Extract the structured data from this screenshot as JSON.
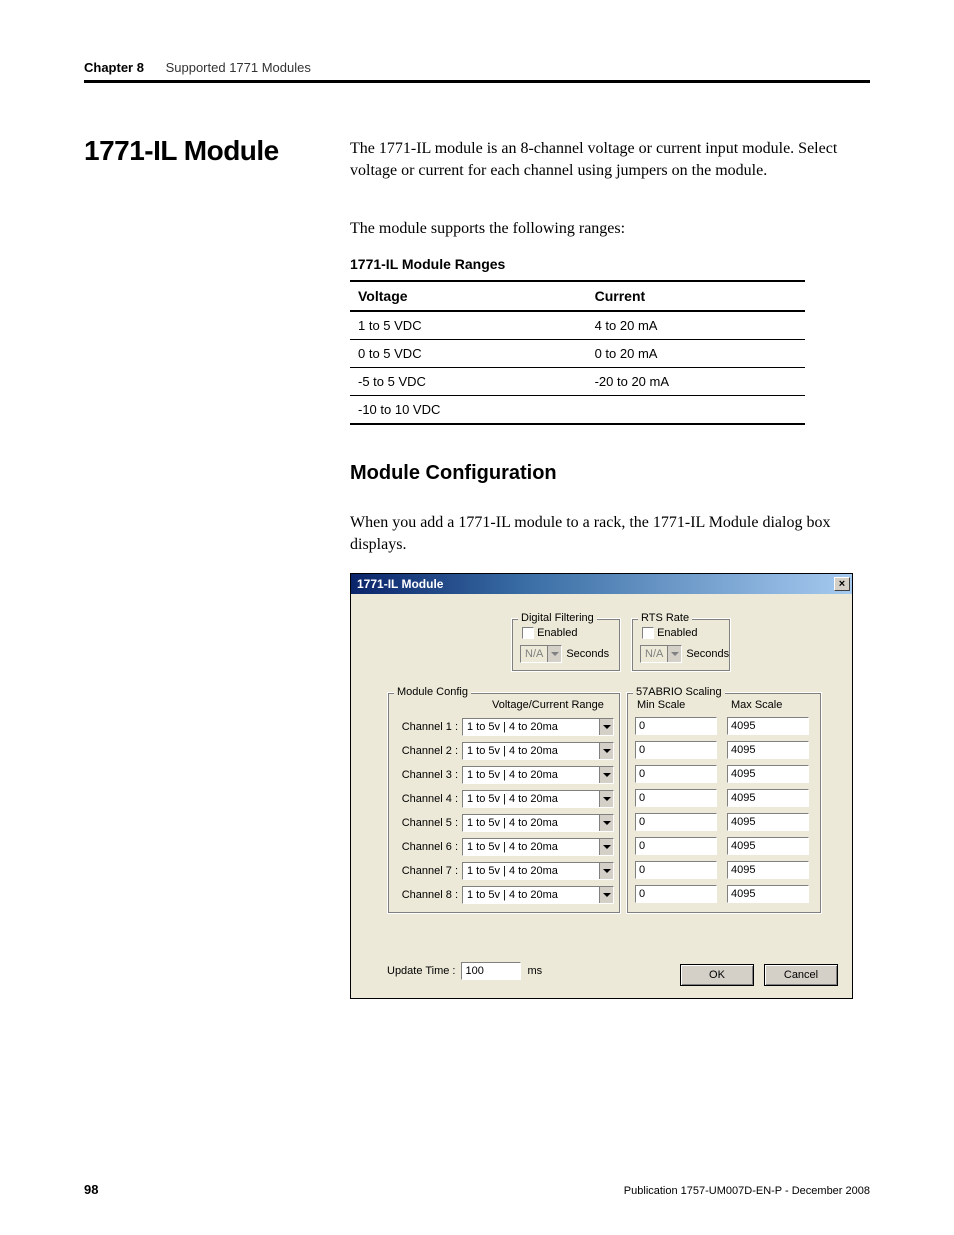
{
  "header": {
    "chapter_label": "Chapter 8",
    "chapter_title": "Supported 1771 Modules"
  },
  "section_heading": "1771-IL Module",
  "paragraph_1": "The 1771-IL module is an 8-channel voltage or current input module. Select voltage or current for each channel using jumpers on the module.",
  "paragraph_2": "The module supports the following ranges:",
  "ranges_table": {
    "caption": "1771-IL Module Ranges",
    "headers": {
      "voltage": "Voltage",
      "current": "Current"
    },
    "rows": [
      {
        "voltage": "1 to 5 VDC",
        "current": "4 to 20 mA"
      },
      {
        "voltage": "0 to 5 VDC",
        "current": "0 to 20 mA"
      },
      {
        "voltage": "-5 to 5 VDC",
        "current": "-20 to 20 mA"
      },
      {
        "voltage": "-10 to 10 VDC",
        "current": ""
      }
    ]
  },
  "sub_heading": "Module Configuration",
  "paragraph_3": "When you add a 1771-IL module to a rack, the 1771-IL Module dialog box displays.",
  "dialog": {
    "title": "1771-IL Module",
    "digital_filtering": {
      "legend": "Digital Filtering",
      "enabled_label": "Enabled",
      "combo_value": "N/A",
      "unit": "Seconds"
    },
    "rts_rate": {
      "legend": "RTS Rate",
      "enabled_label": "Enabled",
      "combo_value": "N/A",
      "unit": "Seconds"
    },
    "module_config": {
      "legend": "Module Config",
      "column_header": "Voltage/Current Range",
      "channels": [
        {
          "label": "Channel 1 :",
          "value": "1 to 5v | 4 to 20ma"
        },
        {
          "label": "Channel 2 :",
          "value": "1 to 5v | 4 to 20ma"
        },
        {
          "label": "Channel 3 :",
          "value": "1 to 5v | 4 to 20ma"
        },
        {
          "label": "Channel 4 :",
          "value": "1 to 5v | 4 to 20ma"
        },
        {
          "label": "Channel 5 :",
          "value": "1 to 5v | 4 to 20ma"
        },
        {
          "label": "Channel 6 :",
          "value": "1 to 5v | 4 to 20ma"
        },
        {
          "label": "Channel 7 :",
          "value": "1 to 5v | 4 to 20ma"
        },
        {
          "label": "Channel 8 :",
          "value": "1 to 5v | 4 to 20ma"
        }
      ]
    },
    "scaling": {
      "legend": "57ABRIO Scaling",
      "min_header": "Min Scale",
      "max_header": "Max Scale",
      "rows": [
        {
          "min": "0",
          "max": "4095"
        },
        {
          "min": "0",
          "max": "4095"
        },
        {
          "min": "0",
          "max": "4095"
        },
        {
          "min": "0",
          "max": "4095"
        },
        {
          "min": "0",
          "max": "4095"
        },
        {
          "min": "0",
          "max": "4095"
        },
        {
          "min": "0",
          "max": "4095"
        },
        {
          "min": "0",
          "max": "4095"
        }
      ]
    },
    "update_time": {
      "label": "Update Time :",
      "value": "100",
      "unit": "ms"
    },
    "buttons": {
      "ok": "OK",
      "cancel": "Cancel"
    }
  },
  "footer": {
    "page_number": "98",
    "publication": "Publication 1757-UM007D-EN-P - December 2008"
  }
}
